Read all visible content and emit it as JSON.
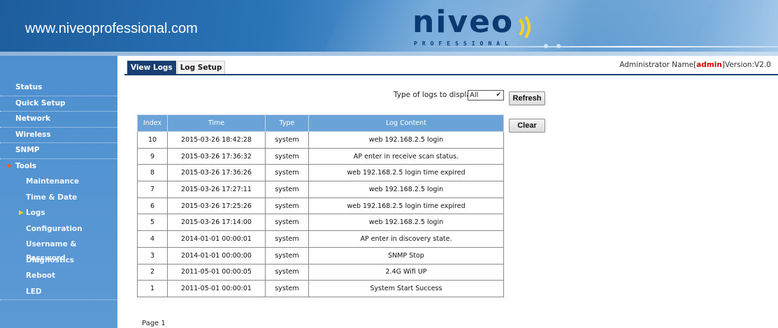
{
  "header": {
    "url": "www.niveoprofessional.com",
    "brand": "niveo",
    "sub_brand": "PROFESSIONAL"
  },
  "sidebar": {
    "items": [
      {
        "label": "Status"
      },
      {
        "label": "Quick Setup"
      },
      {
        "label": "Network"
      },
      {
        "label": "Wireless"
      },
      {
        "label": "SNMP"
      },
      {
        "label": "Tools"
      },
      {
        "label": "Maintenance"
      },
      {
        "label": "Time & Date"
      },
      {
        "label": "Logs"
      },
      {
        "label": "Configuration"
      },
      {
        "label": "Username & Password"
      },
      {
        "label": "Diagnostics"
      },
      {
        "label": "Reboot"
      },
      {
        "label": "LED"
      }
    ]
  },
  "tabs": [
    {
      "label": "View Logs"
    },
    {
      "label": "Log Setup"
    }
  ],
  "admin": {
    "prefix": "Administrator Name[",
    "name": "admin",
    "version_suffix": "]Version:V2.0"
  },
  "filter": {
    "label": "Type of logs to display:",
    "selected": "All"
  },
  "buttons": {
    "refresh": "Refresh",
    "clear": "Clear"
  },
  "table": {
    "headers": [
      "Index",
      "Time",
      "Type",
      "Log Content"
    ],
    "rows": [
      [
        "10",
        "2015-03-26 18:42:28",
        "system",
        "web 192.168.2.5 login"
      ],
      [
        "9",
        "2015-03-26 17:36:32",
        "system",
        "AP enter in receive scan status."
      ],
      [
        "8",
        "2015-03-26 17:36:26",
        "system",
        "web 192.168.2.5 login time expired"
      ],
      [
        "7",
        "2015-03-26 17:27:11",
        "system",
        "web 192.168.2.5 login"
      ],
      [
        "6",
        "2015-03-26 17:25:26",
        "system",
        "web 192.168.2.5 login time expired"
      ],
      [
        "5",
        "2015-03-26 17:14:00",
        "system",
        "web 192.168.2.5 login"
      ],
      [
        "4",
        "2014-01-01 00:00:01",
        "system",
        "AP enter in discovery state."
      ],
      [
        "3",
        "2014-01-01 00:00:00",
        "system",
        "SNMP Stop"
      ],
      [
        "2",
        "2011-05-01 00:00:05",
        "system",
        "2.4G Wifi UP"
      ],
      [
        "1",
        "2011-05-01 00:00:01",
        "system",
        "System Start Success"
      ]
    ]
  },
  "pagination": {
    "label": "Page",
    "page": "1"
  }
}
